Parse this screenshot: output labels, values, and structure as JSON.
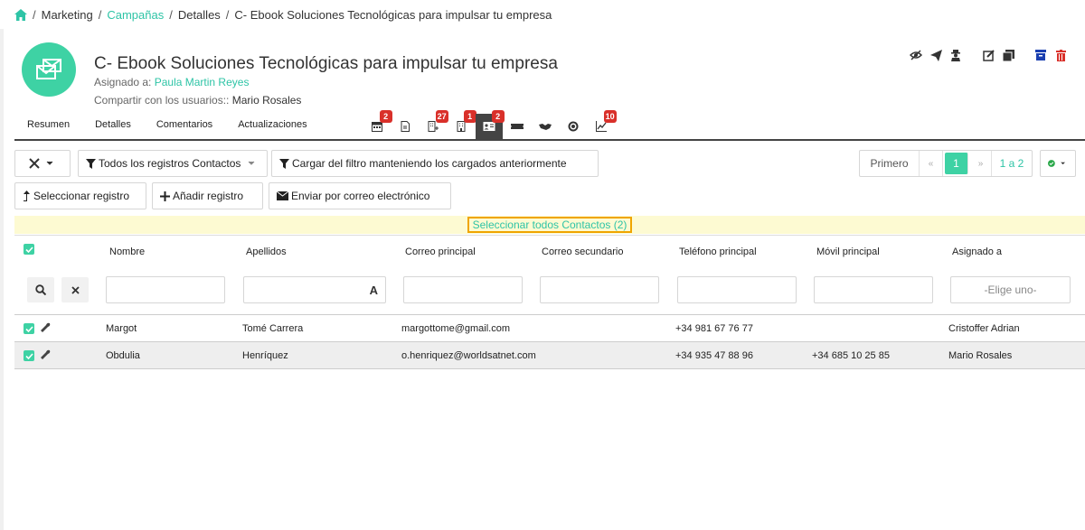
{
  "breadcrumb": {
    "items": [
      "Marketing",
      "Campañas",
      "Detalles",
      "C- Ebook Soluciones Tecnológicas para impulsar tu empresa"
    ],
    "separator": "/"
  },
  "record": {
    "title": "C- Ebook Soluciones Tecnológicas para impulsar tu empresa",
    "assigned_label": "Asignado a:",
    "assigned_value": "Paula Martin Reyes",
    "shared_label": "Compartir con los usuarios::",
    "shared_value": "Mario Rosales"
  },
  "tabs": [
    "Resumen",
    "Detalles",
    "Comentarios",
    "Actualizaciones"
  ],
  "tab_icons": [
    {
      "icon": "calendar-icon",
      "badge": "2"
    },
    {
      "icon": "document-icon",
      "badge": ""
    },
    {
      "icon": "building-plus-icon",
      "badge": "27"
    },
    {
      "icon": "building-icon",
      "badge": "1"
    },
    {
      "icon": "contact-card-icon",
      "badge": "2",
      "active": true
    },
    {
      "icon": "ticket-icon",
      "badge": ""
    },
    {
      "icon": "handshake-icon",
      "badge": ""
    },
    {
      "icon": "target-icon",
      "badge": ""
    },
    {
      "icon": "chart-line-icon",
      "badge": "10"
    }
  ],
  "toolbar": {
    "filter_label": "Todos los registros Contactos",
    "load_filter_label": "Cargar del filtro manteniendo los cargados anteriormente",
    "select_record": "Seleccionar registro",
    "add_record": "Añadir registro",
    "send_email": "Enviar por correo electrónico"
  },
  "pagination": {
    "first": "Primero",
    "prev": "«",
    "current": "1",
    "next": "»",
    "range": "1 a 2"
  },
  "select_all": "Seleccionar todos Contactos (2)",
  "columns": [
    "Nombre",
    "Apellidos",
    "Correo principal",
    "Correo secundario",
    "Teléfono principal",
    "Móvil principal",
    "Asignado a"
  ],
  "filter_select_placeholder": "-Elige uno-",
  "filter_case_toggle": "A",
  "rows": [
    {
      "nombre": "Margot",
      "apellidos": "Tomé Carrera",
      "correo": "margottome@gmail.com",
      "correo2": "",
      "telefono": "+34 981 67 76 77",
      "movil": "",
      "asignado": "Cristoffer Adrian"
    },
    {
      "nombre": "Obdulia",
      "apellidos": "Henríquez",
      "correo": "o.henriquez@worldsatnet.com",
      "correo2": "",
      "telefono": "+34 935 47 88 96",
      "movil": "+34 685 10 25 85",
      "asignado": "Mario Rosales"
    }
  ],
  "colors": {
    "accent": "#3ed2a4",
    "link": "#2ec4a6",
    "badge": "#d9302a",
    "highlight": "#fdfad2",
    "select_border": "#f0a500"
  }
}
